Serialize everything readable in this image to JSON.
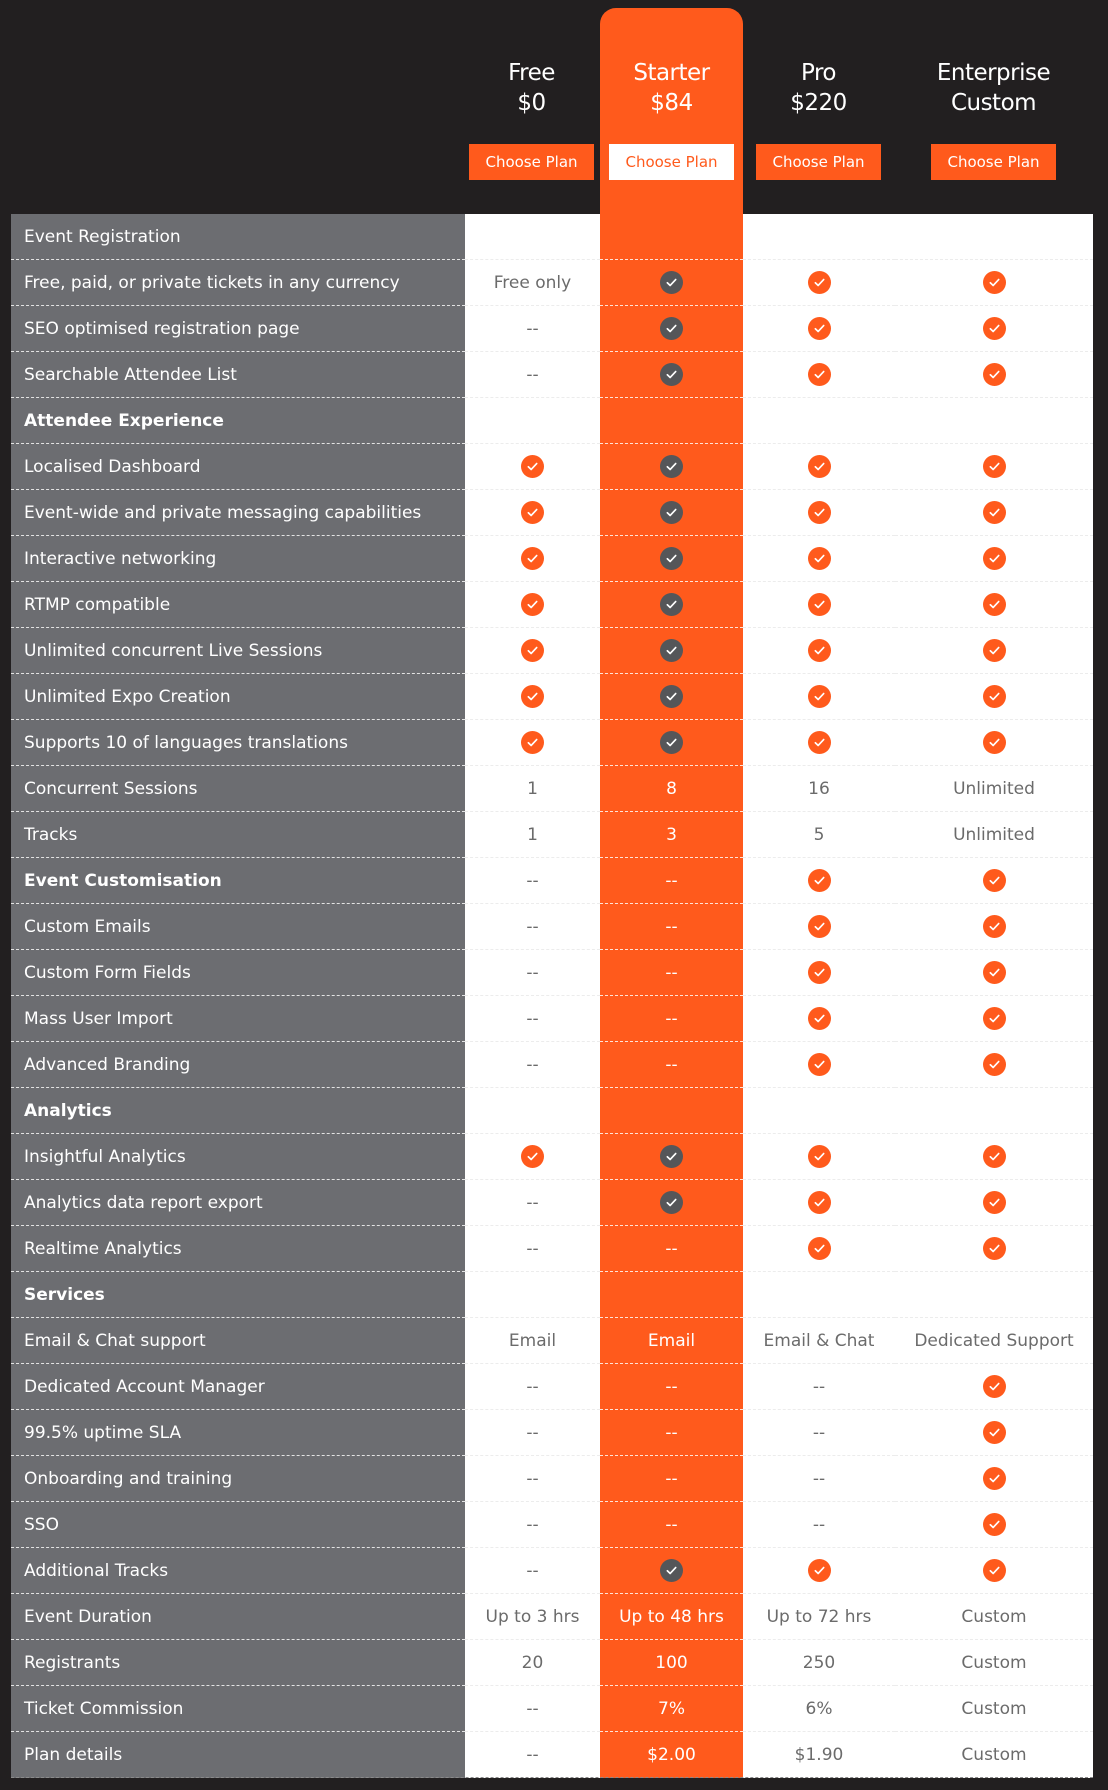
{
  "colors": {
    "accent": "#ff5a1c",
    "background": "#221f20",
    "label_column": "#6c6d71",
    "starter_check": "#555659"
  },
  "plans": [
    {
      "name": "Free",
      "price": "$0",
      "button": "Choose Plan"
    },
    {
      "name": "Starter",
      "price": "$84",
      "button": "Choose Plan",
      "highlighted": true
    },
    {
      "name": "Pro",
      "price": "$220",
      "button": "Choose Plan"
    },
    {
      "name": "Enterprise",
      "price": "Custom",
      "button": "Choose Plan"
    }
  ],
  "rows": [
    {
      "label": "Event Registration",
      "section": true,
      "bold": false,
      "values": [
        "",
        "",
        "",
        ""
      ]
    },
    {
      "label": "Free, paid, or private tickets in any currency",
      "values": [
        "Free only",
        "check",
        "check",
        "check"
      ]
    },
    {
      "label": "SEO optimised registration page",
      "values": [
        "--",
        "check",
        "check",
        "check"
      ]
    },
    {
      "label": "Searchable Attendee List",
      "values": [
        "--",
        "check",
        "check",
        "check"
      ]
    },
    {
      "label": "Attendee Experience",
      "section": true,
      "bold": true,
      "values": [
        "",
        "",
        "",
        ""
      ]
    },
    {
      "label": "Localised Dashboard",
      "values": [
        "check",
        "check",
        "check",
        "check"
      ]
    },
    {
      "label": "Event-wide and private messaging capabilities",
      "values": [
        "check",
        "check",
        "check",
        "check"
      ]
    },
    {
      "label": "Interactive networking",
      "values": [
        "check",
        "check",
        "check",
        "check"
      ]
    },
    {
      "label": "RTMP compatible",
      "values": [
        "check",
        "check",
        "check",
        "check"
      ]
    },
    {
      "label": "Unlimited concurrent Live Sessions",
      "values": [
        "check",
        "check",
        "check",
        "check"
      ]
    },
    {
      "label": "Unlimited Expo Creation",
      "values": [
        "check",
        "check",
        "check",
        "check"
      ]
    },
    {
      "label": "Supports 10 of languages translations",
      "values": [
        "check",
        "check",
        "check",
        "check"
      ]
    },
    {
      "label": "Concurrent Sessions",
      "values": [
        "1",
        "8",
        "16",
        "Unlimited"
      ]
    },
    {
      "label": "Tracks",
      "values": [
        "1",
        "3",
        "5",
        "Unlimited"
      ]
    },
    {
      "label": "Event Customisation",
      "section": true,
      "bold": true,
      "values": [
        "--",
        "--",
        "check",
        "check"
      ]
    },
    {
      "label": "Custom Emails",
      "values": [
        "--",
        "--",
        "check",
        "check"
      ]
    },
    {
      "label": "Custom Form Fields",
      "values": [
        "--",
        "--",
        "check",
        "check"
      ]
    },
    {
      "label": "Mass User Import",
      "values": [
        "--",
        "--",
        "check",
        "check"
      ]
    },
    {
      "label": "Advanced Branding",
      "values": [
        "--",
        "--",
        "check",
        "check"
      ]
    },
    {
      "label": "Analytics",
      "section": true,
      "bold": true,
      "values": [
        "",
        "",
        "",
        ""
      ]
    },
    {
      "label": "Insightful Analytics",
      "values": [
        "check",
        "check",
        "check",
        "check"
      ]
    },
    {
      "label": "Analytics data report export",
      "values": [
        "--",
        "check",
        "check",
        "check"
      ]
    },
    {
      "label": "Realtime Analytics",
      "values": [
        "--",
        "--",
        "check",
        "check"
      ]
    },
    {
      "label": "Services",
      "section": true,
      "bold": true,
      "values": [
        "",
        "",
        "",
        ""
      ]
    },
    {
      "label": "Email & Chat support",
      "values": [
        "Email",
        "Email",
        "Email & Chat",
        "Dedicated Support"
      ]
    },
    {
      "label": "Dedicated Account Manager",
      "values": [
        "--",
        "--",
        "--",
        "check"
      ]
    },
    {
      "label": "99.5% uptime SLA",
      "values": [
        "--",
        "--",
        "--",
        "check"
      ]
    },
    {
      "label": "Onboarding and training",
      "values": [
        "--",
        "--",
        "--",
        "check"
      ]
    },
    {
      "label": "SSO",
      "values": [
        "--",
        "--",
        "--",
        "check"
      ]
    },
    {
      "label": "Additional Tracks",
      "values": [
        "--",
        "check",
        "check",
        "check"
      ]
    },
    {
      "label": "Event Duration",
      "values": [
        "Up to 3 hrs",
        "Up to 48 hrs",
        "Up to 72 hrs",
        "Custom"
      ]
    },
    {
      "label": "Registrants",
      "values": [
        "20",
        "100",
        "250",
        "Custom"
      ]
    },
    {
      "label": "Ticket Commission",
      "values": [
        "--",
        "7%",
        "6%",
        "Custom"
      ]
    },
    {
      "label": "Plan details",
      "values": [
        "--",
        "$2.00",
        "$1.90",
        "Custom"
      ]
    }
  ]
}
